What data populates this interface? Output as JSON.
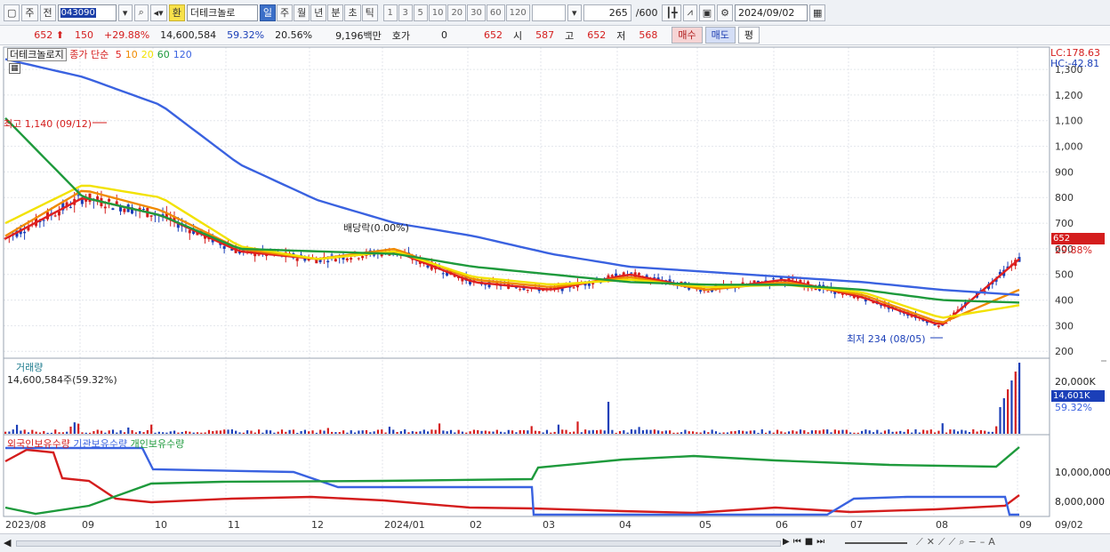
{
  "toolbar": {
    "market_select": "주",
    "prev_btn": "전",
    "stock_code": "043090",
    "exchange_btn": "환",
    "stock_name": "더테크놀로",
    "period_tabs": [
      "일",
      "주",
      "월",
      "년",
      "분",
      "초",
      "틱"
    ],
    "active_period": "일",
    "interval_btns": [
      "1",
      "3",
      "5",
      "10",
      "20",
      "30",
      "60",
      "120"
    ],
    "count_value": "265",
    "count_max": "/600",
    "date_value": "2024/09/02"
  },
  "quote": {
    "price": "652",
    "change": "150",
    "change_rate": "+29.88%",
    "volume": "14,600,584",
    "volume_ratio": "59.32%",
    "turnover": "20.56%",
    "amount": "9,196백만",
    "hoga_label": "호가",
    "hoga_value": "0",
    "ask_price": "652",
    "open_label": "시",
    "open_value": "587",
    "high_label": "고",
    "high_value": "652",
    "low_label": "저",
    "low_value": "568",
    "buy_btn": "매수",
    "sell_btn": "매도",
    "eval_btn": "평"
  },
  "price_pane": {
    "name_label": "더테크놀로지",
    "ma_label": "종가 단순",
    "ma_periods": [
      "5",
      "10",
      "20",
      "60",
      "120"
    ],
    "lc": "LC:178.63",
    "hc": "HC:-42.81",
    "high_annotation": "최고 1,140 (09/12)",
    "low_annotation": "최저 234 (08/05)",
    "dividend_annotation": "배당락(0.00%)",
    "last_price": "652",
    "last_rate": "29.88%",
    "y_ticks": [
      "1,300",
      "1,200",
      "1,100",
      "1,000",
      "900",
      "800",
      "700",
      "600",
      "500",
      "400",
      "300",
      "200"
    ]
  },
  "volume_pane": {
    "title": "거래량",
    "value_label": "14,600,584주(59.32%)",
    "y_tick": "20,000K",
    "last_value": "14,601K",
    "last_ratio": "59.32%"
  },
  "holdings_pane": {
    "labels": [
      "외국인보유수량",
      "기관보유수량",
      "개인보유수량"
    ],
    "y_ticks": [
      "10,000,000",
      "8,000,000"
    ]
  },
  "x_axis": [
    "2023/08",
    "09",
    "10",
    "11",
    "12",
    "2024/01",
    "02",
    "03",
    "04",
    "05",
    "06",
    "07",
    "08",
    "09",
    "09/02"
  ],
  "colors": {
    "up": "#d41d1d",
    "down": "#1b3fb8",
    "ma5": "#e02020",
    "ma10": "#f08a00",
    "ma20": "#f2e200",
    "ma60": "#1e9a3c",
    "ma120": "#3a62e0"
  },
  "chart_data": {
    "type": "line",
    "title": "더테크놀로지",
    "x": [
      "2023/08",
      "09",
      "10",
      "11",
      "12",
      "2024/01",
      "02",
      "03",
      "04",
      "05",
      "06",
      "07",
      "08",
      "09"
    ],
    "series": [
      {
        "name": "5",
        "values": [
          640,
          800,
          730,
          590,
          560,
          590,
          470,
          440,
          500,
          440,
          480,
          410,
          300,
          560
        ]
      },
      {
        "name": "10",
        "values": [
          650,
          830,
          750,
          600,
          560,
          600,
          480,
          450,
          490,
          440,
          470,
          420,
          310,
          440
        ]
      },
      {
        "name": "20",
        "values": [
          700,
          850,
          800,
          610,
          560,
          590,
          490,
          460,
          480,
          450,
          460,
          430,
          330,
          380
        ]
      },
      {
        "name": "60",
        "values": [
          1110,
          800,
          730,
          600,
          590,
          580,
          530,
          500,
          470,
          460,
          460,
          440,
          400,
          390
        ]
      },
      {
        "name": "120",
        "values": [
          1340,
          1270,
          1160,
          930,
          790,
          700,
          650,
          580,
          530,
          510,
          490,
          470,
          440,
          420
        ]
      }
    ],
    "ylim": [
      180,
      1380
    ],
    "grid": true,
    "legend": "top-left"
  }
}
